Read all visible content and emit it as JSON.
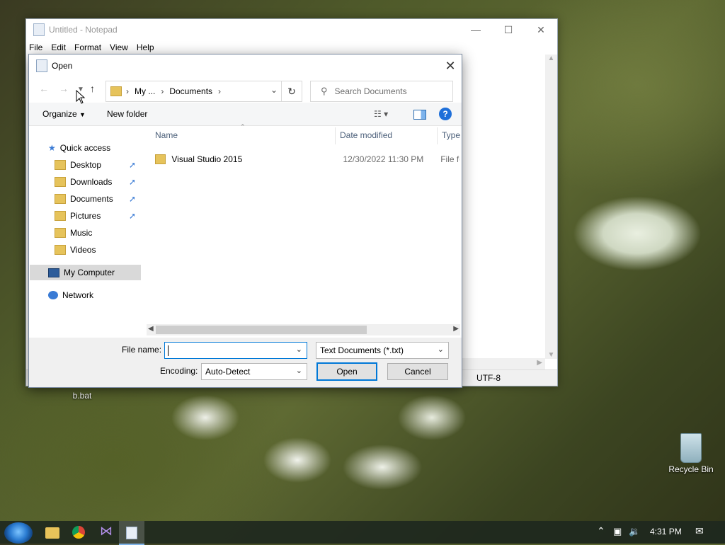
{
  "desktop": {
    "recycle_bin_label": "Recycle Bin",
    "bat_label": "b.bat"
  },
  "notepad": {
    "title": "Untitled - Notepad",
    "menu": [
      "File",
      "Edit",
      "Format",
      "View",
      "Help"
    ],
    "status_encoding": "UTF-8"
  },
  "dialog": {
    "title": "Open",
    "breadcrumb": [
      "My ...",
      "Documents"
    ],
    "search_placeholder": "Search Documents",
    "organize_label": "Organize",
    "new_folder_label": "New folder",
    "nav": {
      "quick_access": "Quick access",
      "items": [
        "Desktop",
        "Downloads",
        "Documents",
        "Pictures",
        "Music",
        "Videos"
      ],
      "my_computer": "My Computer",
      "network": "Network"
    },
    "columns": [
      "Name",
      "Date modified",
      "Type"
    ],
    "files": [
      {
        "name": "Visual Studio 2015",
        "date": "12/30/2022 11:30 PM",
        "type": "File fo"
      }
    ],
    "file_name_label": "File name:",
    "file_name_value": "",
    "filter_value": "Text Documents (*.txt)",
    "encoding_label": "Encoding:",
    "encoding_value": "Auto-Detect",
    "open_label": "Open",
    "cancel_label": "Cancel"
  },
  "taskbar": {
    "time": "4:31 PM"
  },
  "icons": {
    "start": "windows-start-icon",
    "explorer": "file-explorer-icon",
    "chrome": "chrome-icon",
    "vs": "visual-studio-icon",
    "notepad": "notepad-icon"
  },
  "colors": {
    "accent": "#0078d7",
    "folder": "#e6c35b",
    "help": "#1e6fd9"
  }
}
